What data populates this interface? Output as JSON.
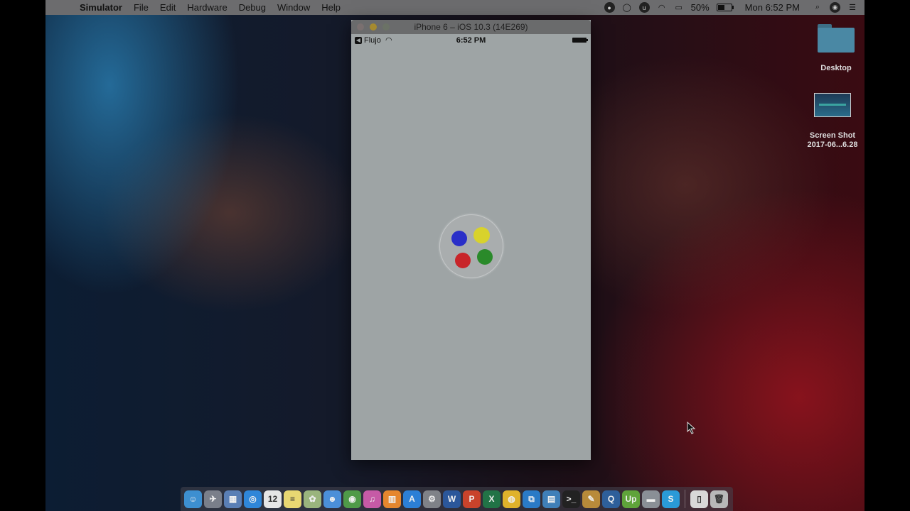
{
  "menubar": {
    "app_name": "Simulator",
    "items": [
      "File",
      "Edit",
      "Hardware",
      "Debug",
      "Window",
      "Help"
    ],
    "battery_percent": "50%",
    "clock": "Mon 6:52 PM",
    "status_icons": [
      "record-icon",
      "messages-icon",
      "upwork-icon",
      "wifi-icon",
      "airplay-icon"
    ]
  },
  "simulator": {
    "window_title": "iPhone 6 – iOS 10.3 (14E269)",
    "status_bar": {
      "back_label": "Flujo",
      "time": "6:52 PM"
    },
    "loader_dot_colors": [
      "#2a2fc8",
      "#d8d22c",
      "#c8252a",
      "#2a8a2a"
    ]
  },
  "desktop": {
    "items": [
      {
        "label": "Desktop",
        "icon": "folder-icon"
      },
      {
        "label_line1": "Screen Shot",
        "label_line2": "2017-06...6.28",
        "icon": "screenshot-thumbnail"
      }
    ]
  },
  "dock": {
    "apps": [
      {
        "name": "finder-icon",
        "color": "#3d8fd0",
        "glyph": "☺"
      },
      {
        "name": "launchpad-icon",
        "color": "#7a7f8a",
        "glyph": "✈"
      },
      {
        "name": "preview-icon",
        "color": "#5a7fb5",
        "glyph": "▦"
      },
      {
        "name": "safari-icon",
        "color": "#2f86d8",
        "glyph": "◎"
      },
      {
        "name": "calendar-icon",
        "color": "#e6e6e6",
        "glyph": "12"
      },
      {
        "name": "notes-icon",
        "color": "#e8d772",
        "glyph": "≡"
      },
      {
        "name": "photos-icon",
        "color": "#9ab47d",
        "glyph": "✿"
      },
      {
        "name": "finder-alt-icon",
        "color": "#4b8fd8",
        "glyph": "☻"
      },
      {
        "name": "photo-booth-icon",
        "color": "#4f9a48",
        "glyph": "◉"
      },
      {
        "name": "itunes-icon",
        "color": "#c65aa6",
        "glyph": "♫"
      },
      {
        "name": "ibooks-icon",
        "color": "#e5862e",
        "glyph": "▥"
      },
      {
        "name": "app-store-icon",
        "color": "#2c7fd6",
        "glyph": "A"
      },
      {
        "name": "system-preferences-icon",
        "color": "#7f8288",
        "glyph": "⚙"
      },
      {
        "name": "word-icon",
        "color": "#2b579a",
        "glyph": "W"
      },
      {
        "name": "powerpoint-icon",
        "color": "#c9432b",
        "glyph": "P"
      },
      {
        "name": "excel-icon",
        "color": "#217346",
        "glyph": "X"
      },
      {
        "name": "chrome-icon",
        "color": "#e0b22b",
        "glyph": "◍"
      },
      {
        "name": "vscode-icon",
        "color": "#2a7ac6",
        "glyph": "⧉"
      },
      {
        "name": "folder-app-icon",
        "color": "#3f7fb8",
        "glyph": "▤"
      },
      {
        "name": "terminal-icon",
        "color": "#222222",
        "glyph": ">_"
      },
      {
        "name": "pen-tool-icon",
        "color": "#b88a3a",
        "glyph": "✎"
      },
      {
        "name": "quicktime-icon",
        "color": "#2e5f9a",
        "glyph": "Q"
      },
      {
        "name": "upwork-icon",
        "color": "#5fa33a",
        "glyph": "Up"
      },
      {
        "name": "scanner-icon",
        "color": "#8a8f96",
        "glyph": "▬"
      },
      {
        "name": "skype-icon",
        "color": "#2a9ad8",
        "glyph": "S"
      },
      {
        "name": "documents-icon",
        "color": "#d8d8d8",
        "glyph": "▯"
      },
      {
        "name": "trash-icon",
        "color": "#b8b8b8",
        "glyph": "🗑"
      }
    ]
  }
}
